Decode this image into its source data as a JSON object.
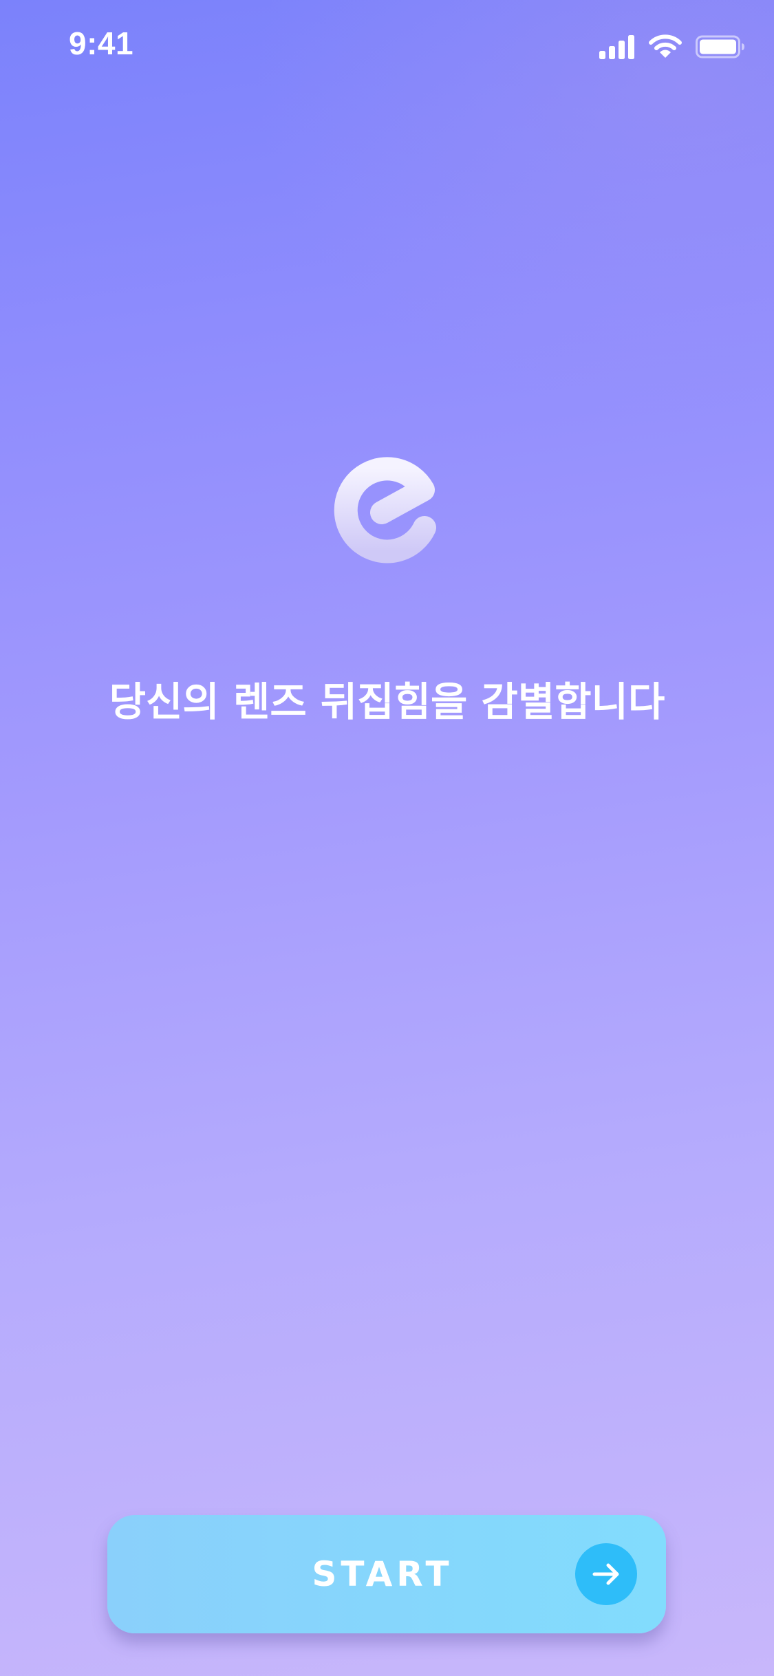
{
  "status_bar": {
    "time": "9:41",
    "icons": [
      "signal-icon",
      "wifi-icon",
      "battery-icon"
    ]
  },
  "logo": {
    "icon": "e-logo-icon"
  },
  "headline": "당신의 렌즈 뒤집힘을 감별합니다",
  "start_button": {
    "label": "START",
    "icon": "arrow-right-icon",
    "accent_color": "#2ebdf9"
  },
  "colors": {
    "background_top": "#7b82fb",
    "background_bottom": "#c8b7fb",
    "button_fill": "#82dcfd",
    "text": "#ffffff"
  }
}
